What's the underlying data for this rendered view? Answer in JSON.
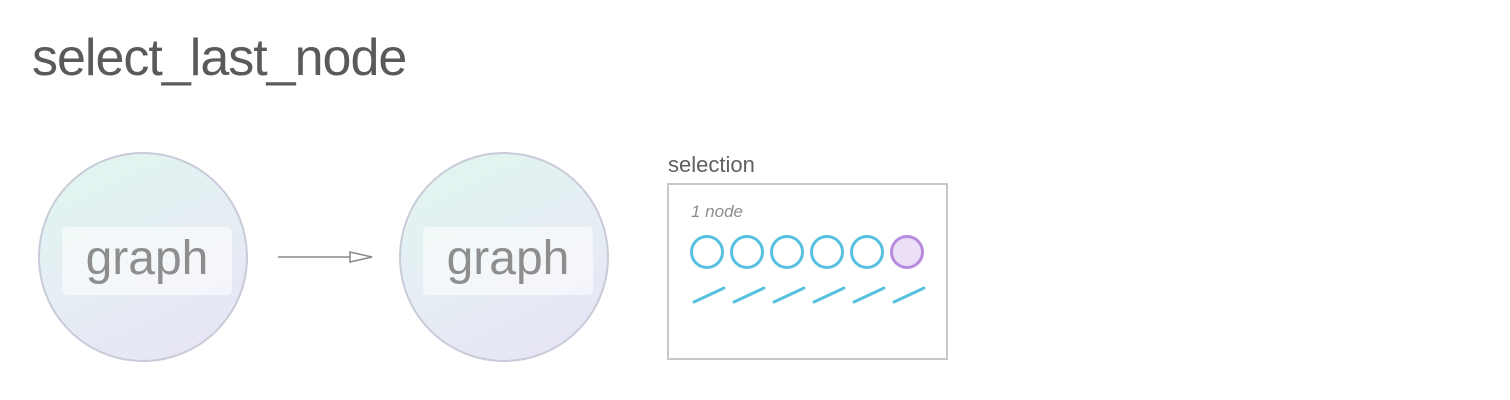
{
  "title": "select_last_node",
  "graph_before": {
    "label": "graph"
  },
  "graph_after": {
    "label": "graph"
  },
  "selection": {
    "title": "selection",
    "count_text": "1 node",
    "nodes": [
      {
        "state": "unselected"
      },
      {
        "state": "unselected"
      },
      {
        "state": "unselected"
      },
      {
        "state": "unselected"
      },
      {
        "state": "unselected"
      },
      {
        "state": "selected"
      }
    ],
    "edges": 6
  },
  "colors": {
    "node_stroke": "#56c1e0",
    "selected_stroke": "#b68be0",
    "selected_fill": "#ecdff8",
    "edge": "#56c1e0",
    "arrow": "#8a8a8a"
  }
}
